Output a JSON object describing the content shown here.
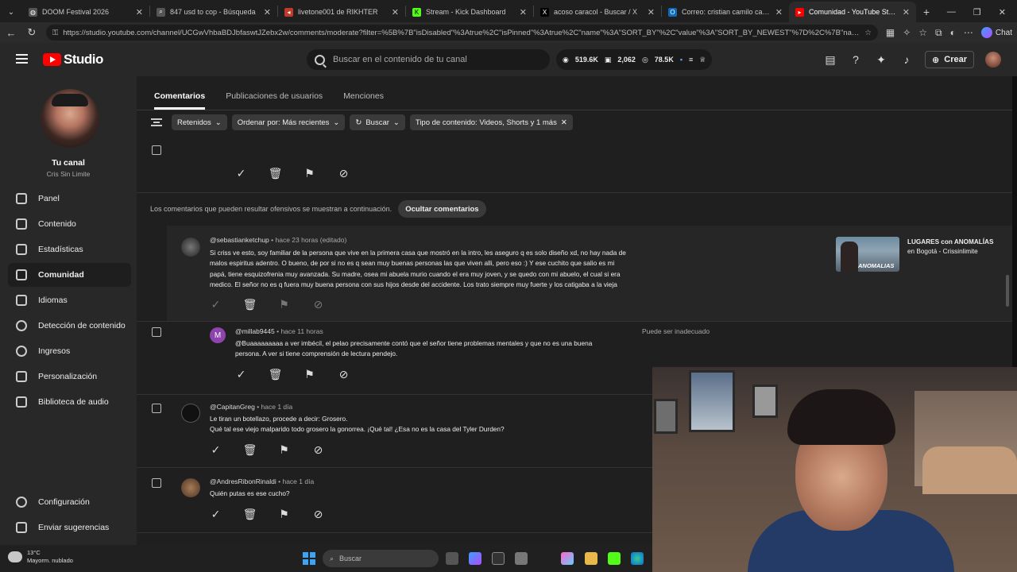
{
  "browser": {
    "tabs": [
      {
        "title": "DOOM Festival 2026",
        "favicon": "globe-icon",
        "color": "#777777"
      },
      {
        "title": "847 usd to cop - Búsqueda",
        "favicon": "search-icon",
        "color": "#777777"
      },
      {
        "title": "livetone001 de RIKHTER",
        "favicon": "mute-icon",
        "color": "#c0392b"
      },
      {
        "title": "Stream - Kick Dashboard",
        "favicon": "kick-icon",
        "color": "#53fc18"
      },
      {
        "title": "acoso caracol - Buscar / X",
        "favicon": "x-icon",
        "color": "#000000"
      },
      {
        "title": "Correo: cristian camilo castro soto",
        "favicon": "outlook-icon",
        "color": "#0f6cbd"
      },
      {
        "title": "Comunidad - YouTube Studio",
        "favicon": "youtube-icon",
        "color": "#ff0000"
      }
    ],
    "url": "https://studio.youtube.com/channel/UCGwVhbaBDJbfaswtJZebx2w/comments/moderate?filter=%5B%7B\"isDisabled\"%3Atrue%2C\"isPinned\"%3Atrue%2C\"name\"%3A\"SORT_BY\"%2C\"value\"%3A\"SORT_BY_NEWEST\"%7D%2C%7B\"name\"%3A\"PARE...",
    "chat_label": "Chat"
  },
  "header": {
    "logo_text": "Studio",
    "search_placeholder": "Buscar en el contenido de tu canal",
    "stats": {
      "subs": "519.6K",
      "comments": "2,062",
      "views": "78.5K"
    },
    "create_label": "Crear"
  },
  "sidebar": {
    "channel_title": "Tu canal",
    "channel_name": "Cris Sin Limite",
    "items": [
      {
        "label": "Panel",
        "icon": "dashboard-icon"
      },
      {
        "label": "Contenido",
        "icon": "content-icon"
      },
      {
        "label": "Estadísticas",
        "icon": "analytics-icon"
      },
      {
        "label": "Comunidad",
        "icon": "community-icon",
        "active": true
      },
      {
        "label": "Idiomas",
        "icon": "languages-icon"
      },
      {
        "label": "Detección de contenido",
        "icon": "copyright-icon"
      },
      {
        "label": "Ingresos",
        "icon": "earn-icon"
      },
      {
        "label": "Personalización",
        "icon": "customization-icon"
      },
      {
        "label": "Biblioteca de audio",
        "icon": "audio-library-icon"
      }
    ],
    "bottom": [
      {
        "label": "Configuración",
        "icon": "settings-icon"
      },
      {
        "label": "Enviar sugerencias",
        "icon": "feedback-icon"
      }
    ]
  },
  "main": {
    "tabs": [
      "Comentarios",
      "Publicaciones de usuarios",
      "Menciones"
    ],
    "filters": {
      "status": "Retenidos",
      "sort": "Ordenar por: Más recientes",
      "search": "Buscar",
      "content_type": "Tipo de contenido: Videos, Shorts y 1 más"
    },
    "warning_text": "Los comentarios que pueden resultar ofensivos se muestran a continuación.",
    "hide_button": "Ocultar comentarios",
    "comments": [
      {
        "author": "@sebastianketchup",
        "time": "hace 23 horas (editado)",
        "lines": [
          "Si criss ve esto, soy familiar de la persona que vive en la primera casa que mostró en la intro, les aseguro q es solo diseño xd, no hay nada de",
          "malos espiritus adentro. O bueno, de por si no es q sean muy buenas personas las que viven alli, pero eso :) Y ese cuchito que salio es mi",
          "papá, tiene esquizofrenia muy avanzada. Su madre, osea mi abuela murio cuando el era muy joven, y se quedo con mi abuelo, el cual si era",
          "medico. El señor no es q fuera muy buena persona con sus hijos desde del accidente. Los trato siempre muy fuerte y los catigaba a la vieja"
        ],
        "video_title": "LUGARES con ANOMALÍAS",
        "video_sub": "en Bogotá - Crissinlimite",
        "thumb_label": "ANOMALIAS"
      },
      {
        "author": "@millab9445",
        "time": "hace 11 horas",
        "avatar_letter": "M",
        "lines": [
          "@Buaaaaaaaaa a ver imbécil, el pelao precisamente contó que el señor tiene problemas mentales y que no es una buena",
          "persona. A ver si tiene comprensión de  lectura pendejo."
        ],
        "flag": "Puede ser inadecuado"
      },
      {
        "author": "@CapitanGreg",
        "time": "hace 1 día",
        "lines": [
          "Le tiran un botellazo, procede a decir: Grosero.",
          "Qué tal ese viejo malparido todo grosero la gonorrea. ¡Qué tal! ¿Esa no es la casa del Tyler Durden?"
        ]
      },
      {
        "author": "@AndresRibonRinaldi",
        "time": "hace 1 día",
        "lines": [
          "Quién putas es ese cucho?"
        ]
      }
    ]
  },
  "taskbar": {
    "temp": "13°C",
    "weather": "Mayorm. nublado",
    "search_placeholder": "Buscar"
  }
}
